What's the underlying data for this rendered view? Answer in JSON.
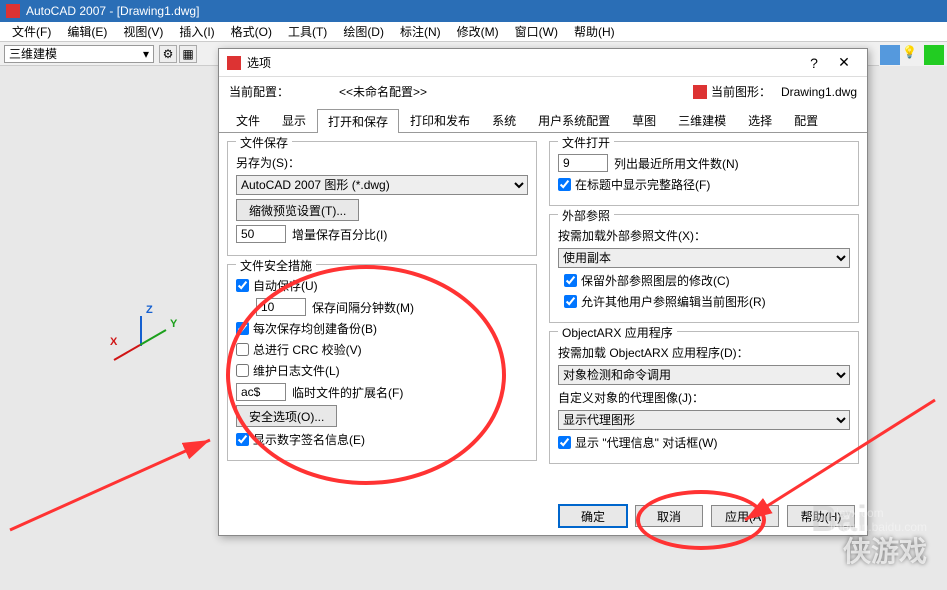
{
  "titlebar": {
    "title": "AutoCAD 2007 - [Drawing1.dwg]"
  },
  "menubar": [
    "文件(F)",
    "编辑(E)",
    "视图(V)",
    "插入(I)",
    "格式(O)",
    "工具(T)",
    "绘图(D)",
    "标注(N)",
    "修改(M)",
    "窗口(W)",
    "帮助(H)"
  ],
  "toolbar": {
    "mode": "三维建模",
    "dropdown_arrow": "▾"
  },
  "axis": {
    "x": "X",
    "y": "Y",
    "z": "Z"
  },
  "dialog": {
    "title": "选项",
    "help": "?",
    "close": "✕",
    "profile_label": "当前配置：",
    "profile_value": "<<未命名配置>>",
    "drawing_label": "当前图形：",
    "drawing_value": "Drawing1.dwg",
    "tabs": [
      "文件",
      "显示",
      "打开和保存",
      "打印和发布",
      "系统",
      "用户系统配置",
      "草图",
      "三维建模",
      "选择",
      "配置"
    ],
    "active_tab": 2,
    "file_save": {
      "legend": "文件保存",
      "saveas_label": "另存为(S)：",
      "format": "AutoCAD 2007 图形 (*.dwg)",
      "thumb_btn": "缩微预览设置(T)...",
      "incr_value": "50",
      "incr_label": "增量保存百分比(I)"
    },
    "safety": {
      "legend": "文件安全措施",
      "autosave": "自动保存(U)",
      "interval_value": "10",
      "interval_label": "保存间隔分钟数(M)",
      "backup": "每次保存均创建备份(B)",
      "crc": "总进行 CRC 校验(V)",
      "log": "维护日志文件(L)",
      "ext_value": "ac$",
      "ext_label": "临时文件的扩展名(F)",
      "sec_btn": "安全选项(O)...",
      "sig": "显示数字签名信息(E)"
    },
    "file_open": {
      "legend": "文件打开",
      "recent_value": "9",
      "recent_label": "列出最近所用文件数(N)",
      "fullpath": "在标题中显示完整路径(F)"
    },
    "xref": {
      "legend": "外部参照",
      "demand_label": "按需加载外部参照文件(X)：",
      "demand_value": "使用副本",
      "retain": "保留外部参照图层的修改(C)",
      "allow": "允许其他用户参照编辑当前图形(R)"
    },
    "arx": {
      "legend": "ObjectARX 应用程序",
      "demand_label": "按需加载 ObjectARX 应用程序(D)：",
      "demand_value": "对象检测和命令调用",
      "proxy_label": "自定义对象的代理图像(J)：",
      "proxy_value": "显示代理图形",
      "show_proxy": "显示 \"代理信息\" 对话框(W)"
    },
    "footer": {
      "ok": "确定",
      "cancel": "取消",
      "apply": "应用(A)",
      "help": "帮助(H)"
    }
  },
  "watermarks": {
    "site": "xiayx.com",
    "game": "侠游戏",
    "baidu": "Bai",
    "jingyan": "jingyan.baidu.com"
  }
}
